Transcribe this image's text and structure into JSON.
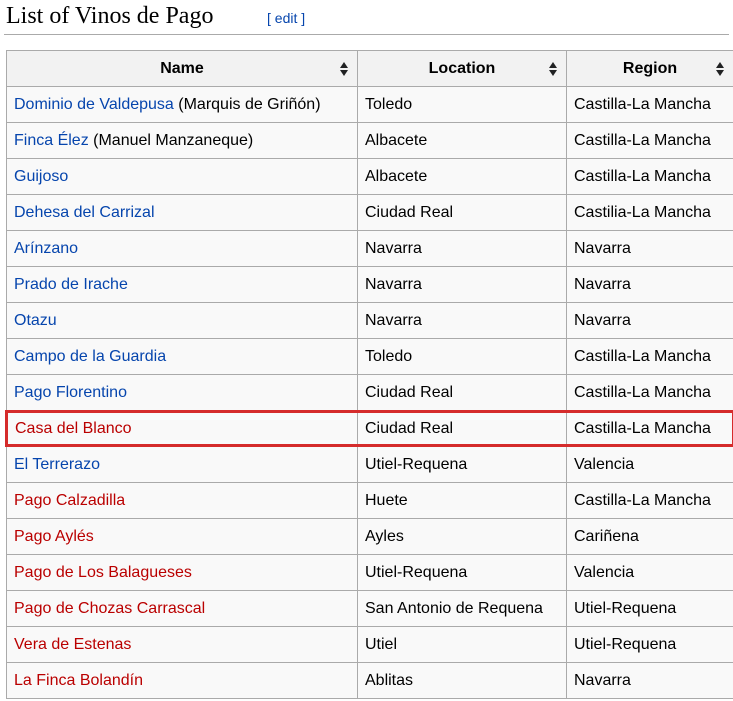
{
  "heading": {
    "title": "List of Vinos de Pago",
    "edit_open": "[",
    "edit_label": "edit",
    "edit_close": "]"
  },
  "table": {
    "columns": [
      "Name",
      "Location",
      "Region"
    ],
    "rows": [
      {
        "name": "Dominio de Valdepusa",
        "note": " (Marquis de Griñón)",
        "link": "blue",
        "location": "Toledo",
        "region": "Castilla-La Mancha"
      },
      {
        "name": "Finca Élez",
        "note": " (Manuel Manzaneque)",
        "link": "blue",
        "location": "Albacete",
        "region": "Castilla-La Mancha"
      },
      {
        "name": "Guijoso",
        "note": "",
        "link": "blue",
        "location": "Albacete",
        "region": "Castilla-La Mancha"
      },
      {
        "name": "Dehesa del Carrizal",
        "note": "",
        "link": "blue",
        "location": "Ciudad Real",
        "region": "Castilia-La Mancha"
      },
      {
        "name": "Arínzano",
        "note": "",
        "link": "blue",
        "location": "Navarra",
        "region": "Navarra"
      },
      {
        "name": "Prado de Irache",
        "note": "",
        "link": "blue",
        "location": "Navarra",
        "region": "Navarra"
      },
      {
        "name": "Otazu",
        "note": "",
        "link": "blue",
        "location": "Navarra",
        "region": "Navarra"
      },
      {
        "name": "Campo de la Guardia",
        "note": "",
        "link": "blue",
        "location": "Toledo",
        "region": "Castilla-La Mancha"
      },
      {
        "name": "Pago Florentino",
        "note": "",
        "link": "blue",
        "location": "Ciudad Real",
        "region": "Castilla-La Mancha"
      },
      {
        "name": "Casa del Blanco",
        "note": "",
        "link": "red",
        "location": "Ciudad Real",
        "region": "Castilla-La Mancha",
        "highlight": true
      },
      {
        "name": "El Terrerazo",
        "note": "",
        "link": "blue",
        "location": "Utiel-Requena",
        "region": "Valencia"
      },
      {
        "name": "Pago Calzadilla",
        "note": "",
        "link": "red",
        "location": "Huete",
        "region": "Castilla-La Mancha"
      },
      {
        "name": "Pago Aylés",
        "note": "",
        "link": "red",
        "location": "Ayles",
        "region": "Cariñena"
      },
      {
        "name": "Pago de Los Balagueses",
        "note": "",
        "link": "red",
        "location": "Utiel-Requena",
        "region": "Valencia"
      },
      {
        "name": "Pago de Chozas Carrascal",
        "note": "",
        "link": "red",
        "location": "San Antonio de Requena",
        "region": "Utiel-Requena"
      },
      {
        "name": "Vera de Estenas",
        "note": "",
        "link": "red",
        "location": "Utiel",
        "region": "Utiel-Requena"
      },
      {
        "name": "La Finca Bolandín",
        "note": "",
        "link": "red",
        "location": "Ablitas",
        "region": "Navarra"
      }
    ]
  },
  "colors": {
    "link_blue": "#0645ad",
    "link_red": "#ba0000",
    "highlight_border": "#d52b2b",
    "header_bg": "#f2f2f2",
    "cell_bg": "#f9f9f9"
  },
  "icons": {
    "sort": "sort-arrows-icon"
  }
}
